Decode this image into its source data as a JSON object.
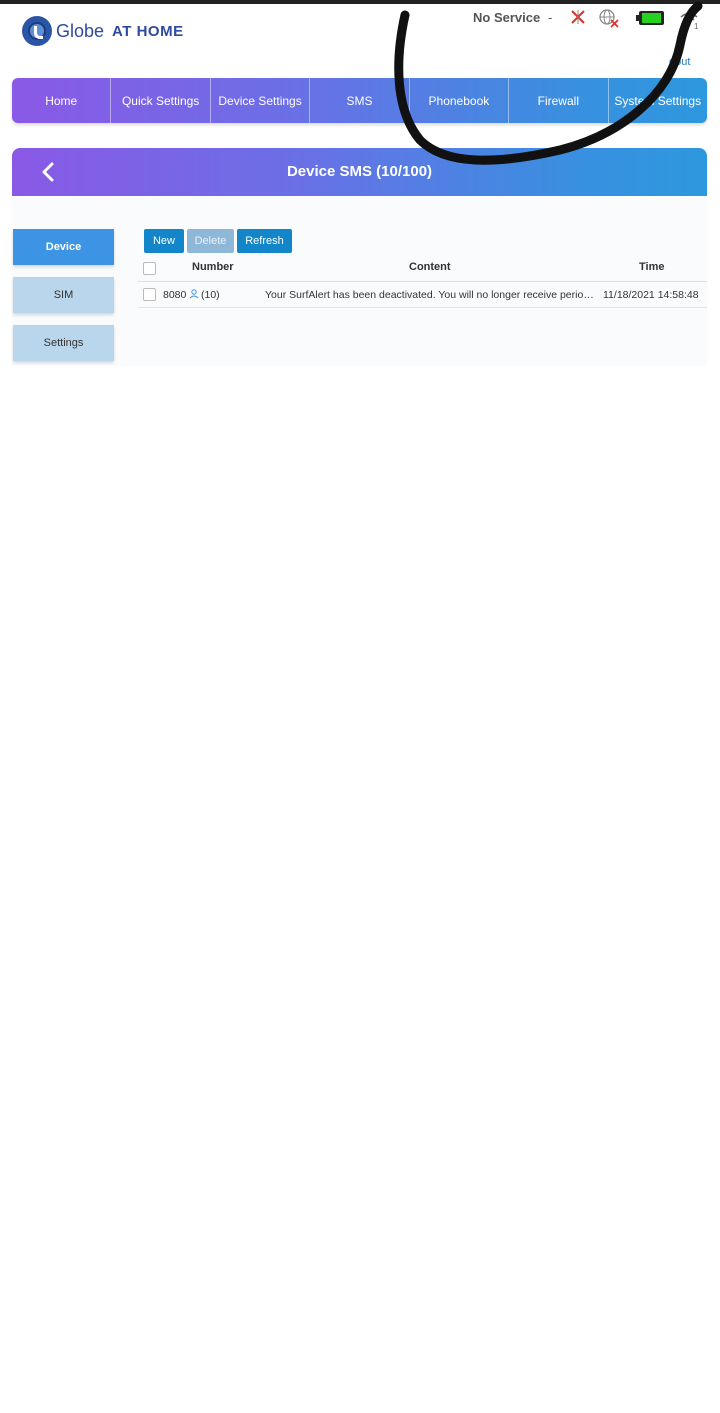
{
  "brand": {
    "name": "Globe",
    "suffix": "AT HOME"
  },
  "status": {
    "service": "No Service",
    "separator": "-",
    "logout": "gout",
    "wifi_count": "1"
  },
  "nav": {
    "items": [
      {
        "label": "Home"
      },
      {
        "label": "Quick Settings"
      },
      {
        "label": "Device Settings"
      },
      {
        "label": "SMS"
      },
      {
        "label": "Phonebook"
      },
      {
        "label": "Firewall"
      },
      {
        "label": "System Settings"
      }
    ]
  },
  "header": {
    "title": "Device SMS (10/100)"
  },
  "sidebar": {
    "items": [
      {
        "label": "Device",
        "active": true
      },
      {
        "label": "SIM",
        "active": false
      },
      {
        "label": "Settings",
        "active": false
      }
    ]
  },
  "toolbar": {
    "new_label": "New",
    "delete_label": "Delete",
    "refresh_label": "Refresh"
  },
  "table": {
    "columns": {
      "number": "Number",
      "content": "Content",
      "time": "Time"
    },
    "rows": [
      {
        "number": "8080",
        "count": "(10)",
        "content": "Your SurfAlert has been deactivated. You will no longer receive periodi...",
        "time": "11/18/2021 14:58:48"
      }
    ]
  },
  "colors": {
    "accent": "#1286c9",
    "nav_start": "#8a59e6",
    "nav_end": "#2d98de",
    "active_side": "#3d94e4"
  }
}
